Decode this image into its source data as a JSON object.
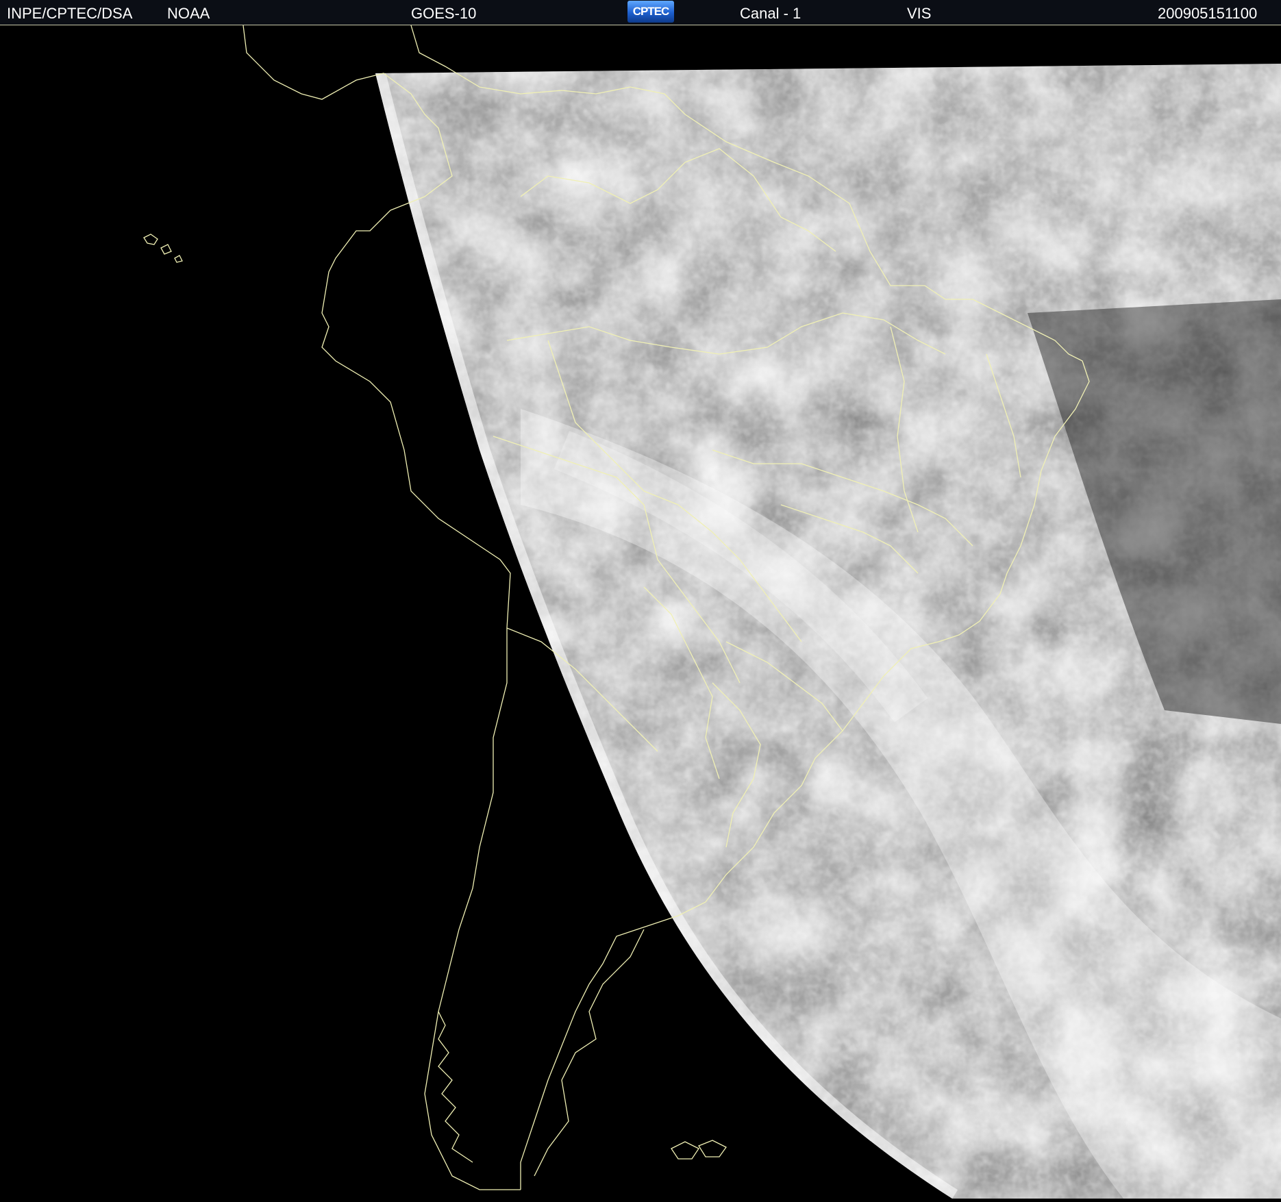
{
  "header": {
    "agency": "INPE/CPTEC/DSA",
    "operator": "NOAA",
    "satellite": "GOES-10",
    "logo_text": "CPTEC",
    "channel": "Canal - 1",
    "band": "VIS",
    "timestamp": "200905151100"
  },
  "colors": {
    "background": "#000000",
    "coastline": "#f0f0b4",
    "header_text": "#ffffff"
  }
}
